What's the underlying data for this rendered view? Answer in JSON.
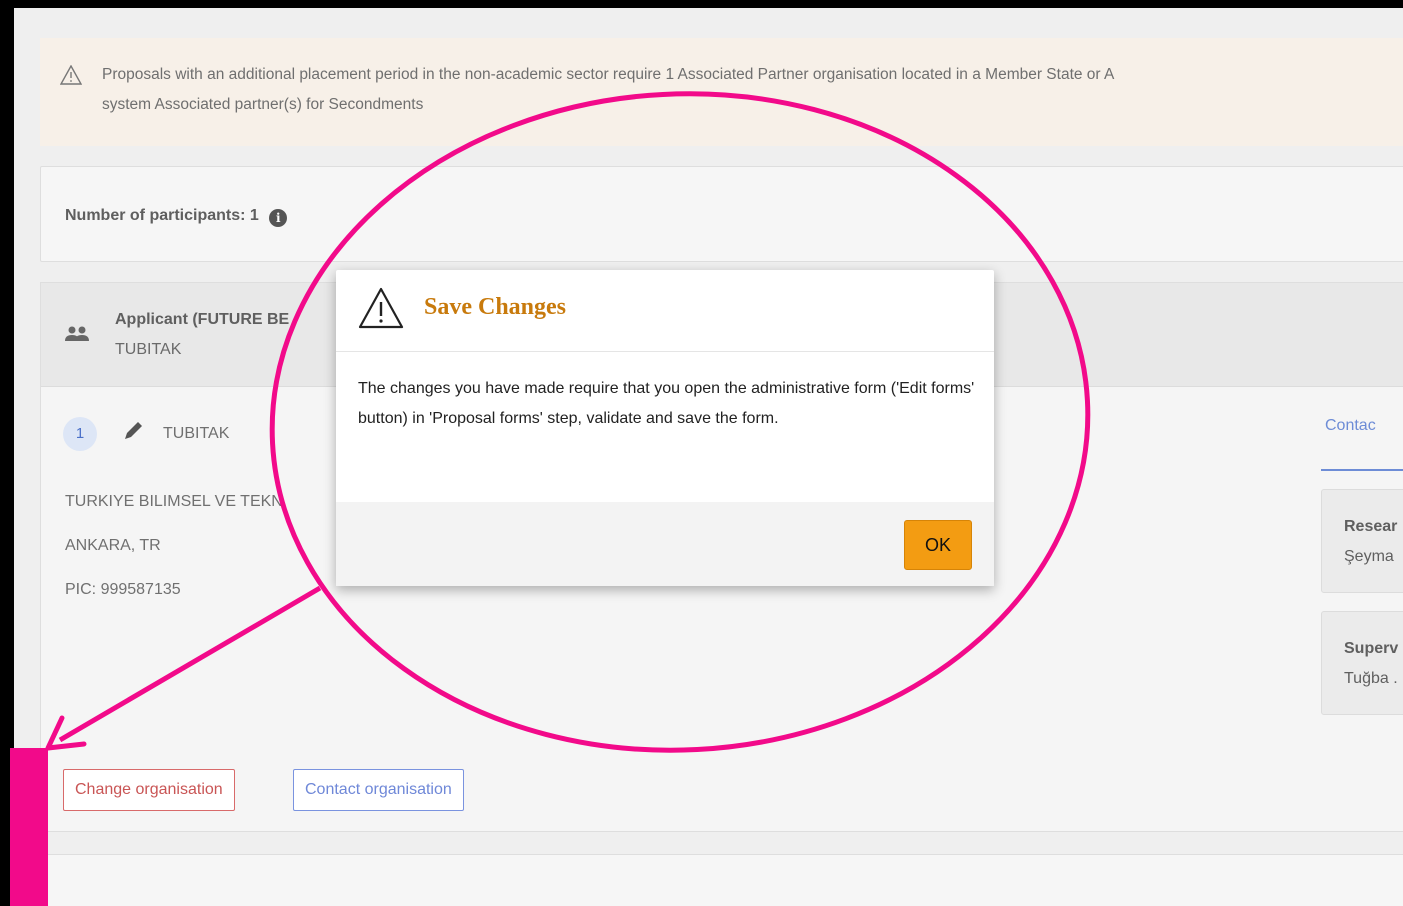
{
  "banner": {
    "line1": "Proposals with an additional placement period in the non-academic sector require 1 Associated Partner organisation located in a Member State or A",
    "line2": "system Associated partner(s) for Secondments"
  },
  "participants": {
    "label": "Number of participants: 1",
    "info_icon": "i"
  },
  "applicant": {
    "title": "Applicant (FUTURE BE",
    "subtitle": "TUBITAK",
    "number": "1",
    "org_short": "TUBITAK",
    "org_full": "TURKIYE BILIMSEL VE TEKN",
    "location": "ANKARA, TR",
    "pic": "PIC: 999587135"
  },
  "buttons": {
    "change": "Change organisation",
    "contact": "Contact organisation"
  },
  "contacts": {
    "tab_label": "Contac",
    "cards": [
      {
        "role": "Resear",
        "name": "Şeyma"
      },
      {
        "role": "Superv",
        "name": "Tuğba ."
      }
    ]
  },
  "modal": {
    "title": "Save Changes",
    "body": "The changes you have made require that you open the administrative form ('Edit forms' button) in 'Proposal forms' step, validate and save the form.",
    "ok_label": "OK"
  },
  "colors": {
    "highlight": "#f20a8a",
    "modal_title": "#c87a0c",
    "ok_button": "#f39c12"
  }
}
